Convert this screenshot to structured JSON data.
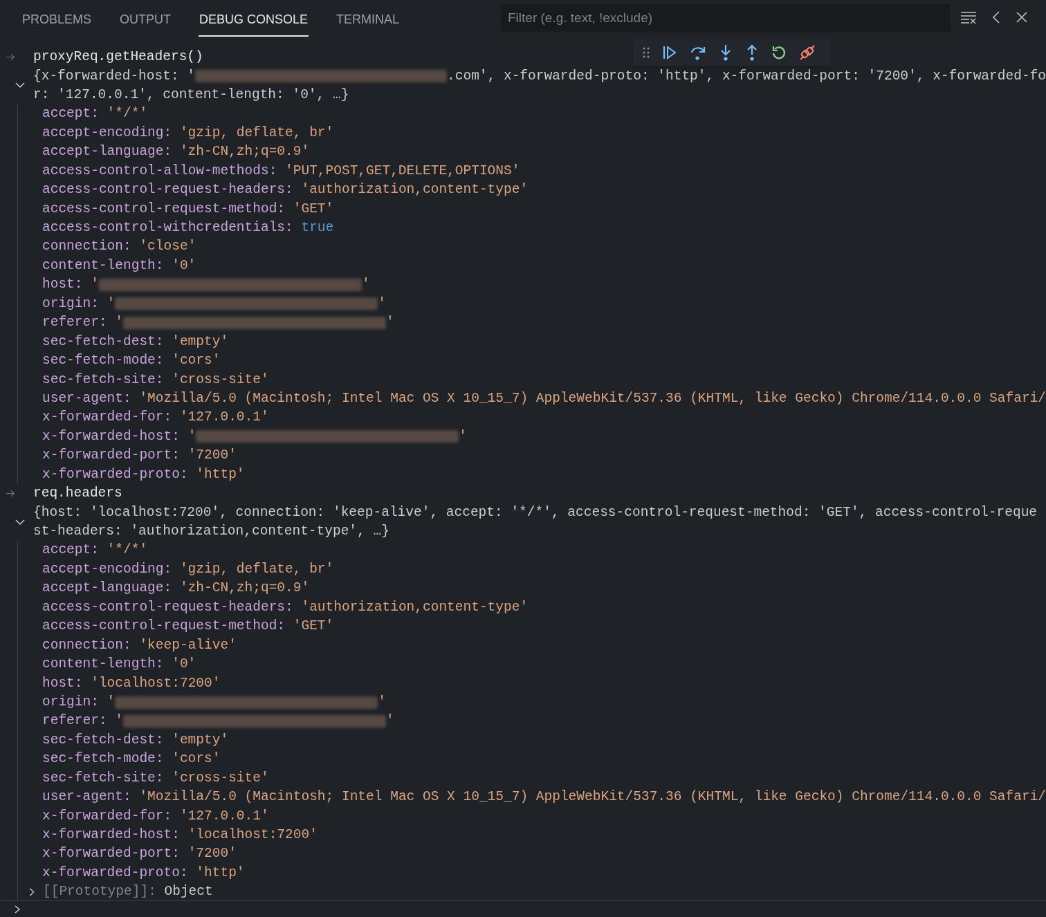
{
  "panel_tabs": [
    {
      "label": "PROBLEMS",
      "selected": false
    },
    {
      "label": "OUTPUT",
      "selected": false
    },
    {
      "label": "DEBUG CONSOLE",
      "selected": true
    },
    {
      "label": "TERMINAL",
      "selected": false
    }
  ],
  "filter": {
    "placeholder": "Filter (e.g. text, !exclude)"
  },
  "console": [
    {
      "kind": "input",
      "text": "proxyReq.getHeaders()"
    },
    {
      "kind": "object",
      "expanded": true,
      "summary": [
        [
          {
            "kind": "plain",
            "text": "{x-forwarded-host: '"
          },
          {
            "kind": "redacted"
          },
          {
            "kind": "plain",
            "text": ".com', x-forwarded-proto: 'http', x-forwarded-port: '7200', x-forwarded-fo"
          }
        ],
        [
          {
            "kind": "plain",
            "text": "r: '127.0.0.1', content-length: '0', …}"
          }
        ]
      ],
      "properties": [
        {
          "key": "accept:",
          "value": [
            {
              "kind": "string",
              "text": "'*/*'"
            }
          ]
        },
        {
          "key": "accept-encoding:",
          "value": [
            {
              "kind": "string",
              "text": "'gzip, deflate, br'"
            }
          ]
        },
        {
          "key": "accept-language:",
          "value": [
            {
              "kind": "string",
              "text": "'zh-CN,zh;q=0.9'"
            }
          ]
        },
        {
          "key": "access-control-allow-methods:",
          "value": [
            {
              "kind": "string",
              "text": "'PUT,POST,GET,DELETE,OPTIONS'"
            }
          ]
        },
        {
          "key": "access-control-request-headers:",
          "value": [
            {
              "kind": "string",
              "text": "'authorization,content-type'"
            }
          ]
        },
        {
          "key": "access-control-request-method:",
          "value": [
            {
              "kind": "string",
              "text": "'GET'"
            }
          ]
        },
        {
          "key": "access-control-withcredentials:",
          "value": [
            {
              "kind": "bool",
              "text": "true"
            }
          ]
        },
        {
          "key": "connection:",
          "value": [
            {
              "kind": "string",
              "text": "'close'"
            }
          ]
        },
        {
          "key": "content-length:",
          "value": [
            {
              "kind": "string",
              "text": "'0'"
            }
          ]
        },
        {
          "key": "host:",
          "value": [
            {
              "kind": "string",
              "text": "'"
            },
            {
              "kind": "redacted"
            },
            {
              "kind": "string",
              "text": "'"
            }
          ]
        },
        {
          "key": "origin:",
          "value": [
            {
              "kind": "string",
              "text": "'"
            },
            {
              "kind": "redacted"
            },
            {
              "kind": "string",
              "text": "'"
            }
          ]
        },
        {
          "key": "referer:",
          "value": [
            {
              "kind": "string",
              "text": "'"
            },
            {
              "kind": "redacted"
            },
            {
              "kind": "string",
              "text": "'"
            }
          ]
        },
        {
          "key": "sec-fetch-dest:",
          "value": [
            {
              "kind": "string",
              "text": "'empty'"
            }
          ]
        },
        {
          "key": "sec-fetch-mode:",
          "value": [
            {
              "kind": "string",
              "text": "'cors'"
            }
          ]
        },
        {
          "key": "sec-fetch-site:",
          "value": [
            {
              "kind": "string",
              "text": "'cross-site'"
            }
          ]
        },
        {
          "key": "user-agent:",
          "value": [
            {
              "kind": "string",
              "text": "'Mozilla/5.0 (Macintosh; Intel Mac OS X 10_15_7) AppleWebKit/537.36 (KHTML, like Gecko) Chrome/114.0.0.0 Safari/"
            }
          ]
        },
        {
          "key": "x-forwarded-for:",
          "value": [
            {
              "kind": "string",
              "text": "'127.0.0.1'"
            }
          ]
        },
        {
          "key": "x-forwarded-host:",
          "value": [
            {
              "kind": "string",
              "text": "'"
            },
            {
              "kind": "redacted"
            },
            {
              "kind": "string",
              "text": "'"
            }
          ]
        },
        {
          "key": "x-forwarded-port:",
          "value": [
            {
              "kind": "string",
              "text": "'7200'"
            }
          ]
        },
        {
          "key": "x-forwarded-proto:",
          "value": [
            {
              "kind": "string",
              "text": "'http'"
            }
          ]
        }
      ]
    },
    {
      "kind": "input",
      "text": "req.headers"
    },
    {
      "kind": "object",
      "expanded": true,
      "summary": [
        [
          {
            "kind": "plain",
            "text": "{host: 'localhost:7200', connection: 'keep-alive', accept: '*/*', access-control-request-method: 'GET', access-control-reque"
          }
        ],
        [
          {
            "kind": "plain",
            "text": "st-headers: 'authorization,content-type', …}"
          }
        ]
      ],
      "properties": [
        {
          "key": "accept:",
          "value": [
            {
              "kind": "string",
              "text": "'*/*'"
            }
          ]
        },
        {
          "key": "accept-encoding:",
          "value": [
            {
              "kind": "string",
              "text": "'gzip, deflate, br'"
            }
          ]
        },
        {
          "key": "accept-language:",
          "value": [
            {
              "kind": "string",
              "text": "'zh-CN,zh;q=0.9'"
            }
          ]
        },
        {
          "key": "access-control-request-headers:",
          "value": [
            {
              "kind": "string",
              "text": "'authorization,content-type'"
            }
          ]
        },
        {
          "key": "access-control-request-method:",
          "value": [
            {
              "kind": "string",
              "text": "'GET'"
            }
          ]
        },
        {
          "key": "connection:",
          "value": [
            {
              "kind": "string",
              "text": "'keep-alive'"
            }
          ]
        },
        {
          "key": "content-length:",
          "value": [
            {
              "kind": "string",
              "text": "'0'"
            }
          ]
        },
        {
          "key": "host:",
          "value": [
            {
              "kind": "string",
              "text": "'localhost:7200'"
            }
          ]
        },
        {
          "key": "origin:",
          "value": [
            {
              "kind": "string",
              "text": "'"
            },
            {
              "kind": "redacted"
            },
            {
              "kind": "string",
              "text": "'"
            }
          ]
        },
        {
          "key": "referer:",
          "value": [
            {
              "kind": "string",
              "text": "'"
            },
            {
              "kind": "redacted"
            },
            {
              "kind": "string",
              "text": "'"
            }
          ]
        },
        {
          "key": "sec-fetch-dest:",
          "value": [
            {
              "kind": "string",
              "text": "'empty'"
            }
          ]
        },
        {
          "key": "sec-fetch-mode:",
          "value": [
            {
              "kind": "string",
              "text": "'cors'"
            }
          ]
        },
        {
          "key": "sec-fetch-site:",
          "value": [
            {
              "kind": "string",
              "text": "'cross-site'"
            }
          ]
        },
        {
          "key": "user-agent:",
          "value": [
            {
              "kind": "string",
              "text": "'Mozilla/5.0 (Macintosh; Intel Mac OS X 10_15_7) AppleWebKit/537.36 (KHTML, like Gecko) Chrome/114.0.0.0 Safari/"
            }
          ]
        },
        {
          "key": "x-forwarded-for:",
          "value": [
            {
              "kind": "string",
              "text": "'127.0.0.1'"
            }
          ]
        },
        {
          "key": "x-forwarded-host:",
          "value": [
            {
              "kind": "string",
              "text": "'localhost:7200'"
            }
          ]
        },
        {
          "key": "x-forwarded-port:",
          "value": [
            {
              "kind": "string",
              "text": "'7200'"
            }
          ]
        },
        {
          "key": "x-forwarded-proto:",
          "value": [
            {
              "kind": "string",
              "text": "'http'"
            }
          ]
        }
      ],
      "prototype": {
        "label": "[[Prototype]]",
        "separator": ":",
        "value": "Object",
        "expanded": false
      }
    }
  ]
}
